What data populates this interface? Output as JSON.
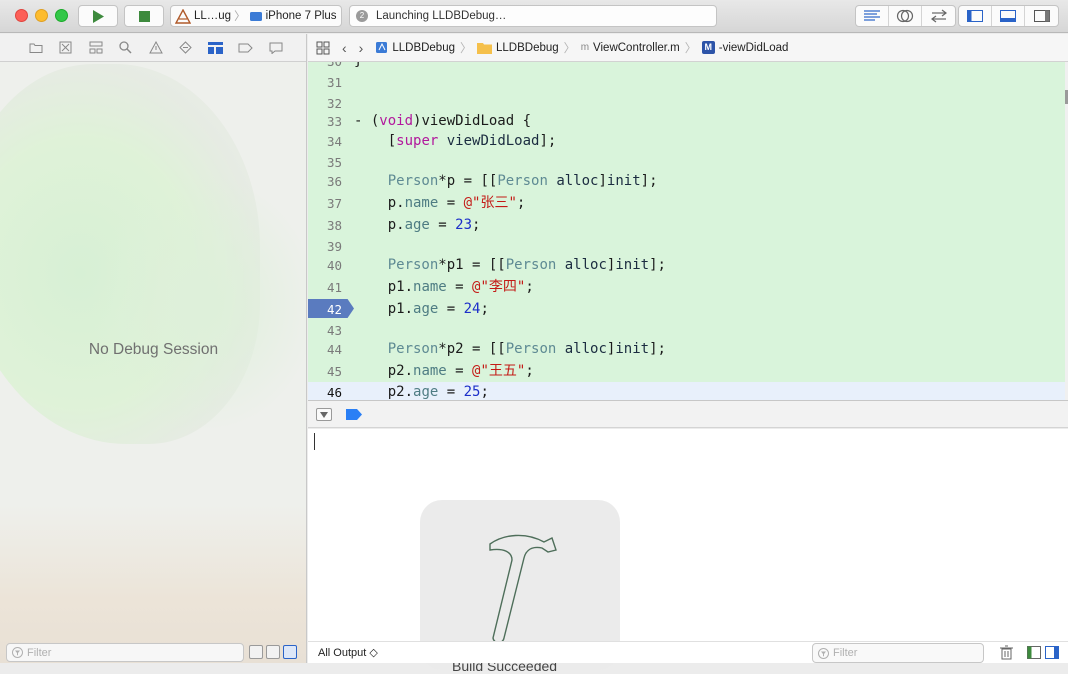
{
  "toolbar": {
    "scheme_target": "LL…ug",
    "scheme_device": "iPhone 7 Plus",
    "activity_badge": "2",
    "activity_text": "Launching LLDBDebug…"
  },
  "navigator": {
    "status": "No Debug Session",
    "filter_placeholder": "Filter"
  },
  "jumpbar": {
    "crumbs": [
      "LLDBDebug",
      "LLDBDebug",
      "ViewController.m",
      "-viewDidLoad"
    ],
    "method_badge": "M"
  },
  "editor": {
    "lines": [
      {
        "n": "31"
      },
      {
        "n": "32"
      },
      {
        "n": "33"
      },
      {
        "n": "34"
      },
      {
        "n": "35"
      },
      {
        "n": "36"
      },
      {
        "n": "37"
      },
      {
        "n": "38"
      },
      {
        "n": "39"
      },
      {
        "n": "40"
      },
      {
        "n": "41"
      },
      {
        "n": "42"
      },
      {
        "n": "43"
      },
      {
        "n": "44"
      },
      {
        "n": "45"
      },
      {
        "n": "46"
      }
    ],
    "breakpoint_line": "42"
  },
  "console": {
    "output_selector": "All Output ◇",
    "filter_placeholder": "Filter",
    "build_label": "Build Succeeded"
  },
  "colors": {
    "editor_bg": "#d9f4db",
    "breakpoint": "#5a7bbf",
    "keyword": "#b2189c",
    "string": "#c41a16",
    "number": "#1c2fc9"
  }
}
